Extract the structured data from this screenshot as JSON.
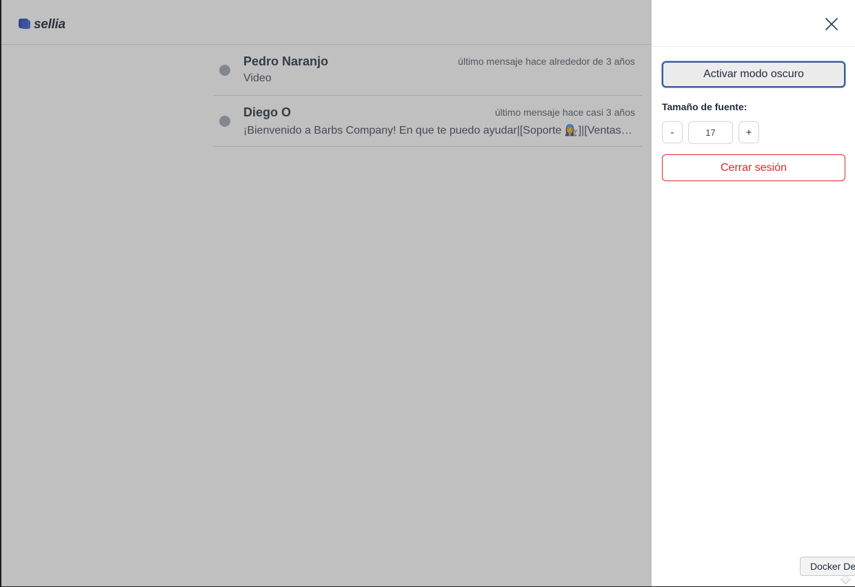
{
  "header": {
    "logo_text": "sellia"
  },
  "chats": [
    {
      "name": "Pedro Naranjo",
      "time": "último mensaje hace alrededor de 3 años",
      "preview": "Video"
    },
    {
      "name": "Diego O",
      "time": "último mensaje hace casi 3 años",
      "preview": "¡Bienvenido a Barbs Company! En que te puedo ayudar|[Soporte 👩‍🔧]|[Ventas 🧑‍💼]"
    }
  ],
  "panel": {
    "dark_mode_label": "Activar modo oscuro",
    "font_size_label": "Tamaño de fuente:",
    "decrease_label": "-",
    "font_size_value": "17",
    "increase_label": "+",
    "logout_label": "Cerrar sesión"
  },
  "tooltip": {
    "text": "Docker Desktop"
  },
  "colors": {
    "logo_blue": "#1e3aa8",
    "logout_red": "#dc2626",
    "focus_border": "#3b5998",
    "avatar_gray": "#9ca3af"
  }
}
